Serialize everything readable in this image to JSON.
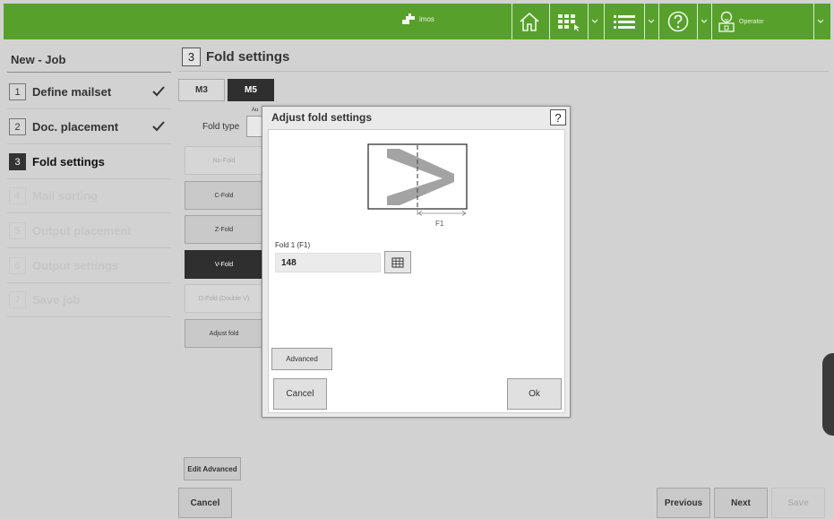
{
  "colors": {
    "brand_green": "#57a02c",
    "selected": "#2f2f2f",
    "fold_preview": "#a3a3a3"
  },
  "header": {
    "brand_label": "imos",
    "operator_label": "Operator",
    "icons": [
      "logo-icon",
      "home-icon",
      "job-grid-icon",
      "list-icon",
      "help-icon",
      "operator-icon"
    ]
  },
  "sidebar": {
    "title": "New - Job",
    "steps": [
      {
        "num": "1",
        "label": "Define mailset",
        "state": "done"
      },
      {
        "num": "2",
        "label": "Doc. placement",
        "state": "done"
      },
      {
        "num": "3",
        "label": "Fold settings",
        "state": "active"
      },
      {
        "num": "4",
        "label": "Mail sorting",
        "state": "disabled"
      },
      {
        "num": "5",
        "label": "Output placement",
        "state": "disabled"
      },
      {
        "num": "6",
        "label": "Output settings",
        "state": "disabled"
      },
      {
        "num": "7",
        "label": "Save job",
        "state": "disabled"
      }
    ]
  },
  "main": {
    "step_num": "3",
    "title": "Fold settings",
    "tabs": [
      {
        "label": "M3"
      },
      {
        "label": "M5"
      }
    ],
    "fold_type_label": "Fold type",
    "fold_auto_label": "Au",
    "fold_buttons": [
      {
        "label": "No-Fold",
        "state": "disabled"
      },
      {
        "label": "C-Fold",
        "state": "normal"
      },
      {
        "label": "Z-Fold",
        "state": "normal"
      },
      {
        "label": "V-Fold",
        "state": "selected"
      },
      {
        "label": "D-Fold (Double V)",
        "state": "disabled"
      },
      {
        "label": "Adjust fold",
        "state": "normal"
      }
    ],
    "edit_advanced_label": "Edit Advanced",
    "cancel_label": "Cancel",
    "previous_label": "Previous",
    "next_label": "Next",
    "save_label": "Save"
  },
  "dialog": {
    "title": "Adjust fold settings",
    "help_label": "?",
    "f1_label": "F1",
    "fold1_label": "Fold 1 (F1)",
    "fold1_value": "148",
    "advanced_label": "Advanced",
    "cancel_label": "Cancel",
    "ok_label": "Ok"
  }
}
